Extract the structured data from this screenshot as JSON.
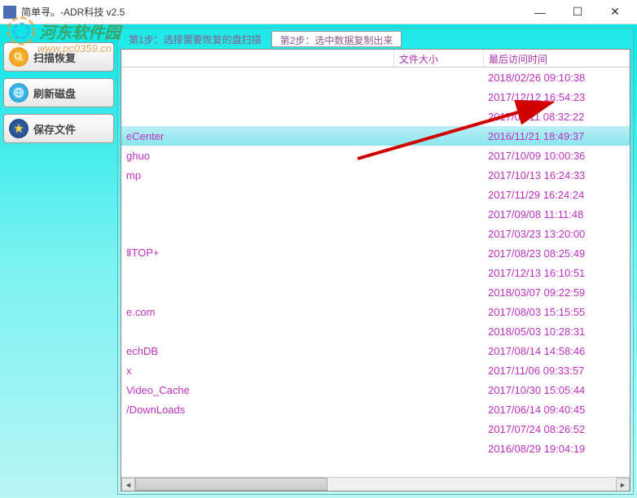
{
  "window": {
    "title": "简单寻。-ADR科技 v2.5"
  },
  "sidebar": {
    "scan_label": "扫描恢复",
    "refresh_label": "刷新磁盘",
    "save_label": "保存文件"
  },
  "steps": {
    "step1": "第1步：选择需要恢复的盘扫描",
    "step2": "第2步：选中数据复制出来"
  },
  "columns": {
    "name": "",
    "size": "文件大小",
    "date": "最后访问时间"
  },
  "rows": [
    {
      "name": "",
      "size": "",
      "date": "2018/02/26 09:10:38",
      "selected": false
    },
    {
      "name": "",
      "size": "",
      "date": "2017/12/12 16:54:23",
      "selected": false
    },
    {
      "name": "",
      "size": "",
      "date": "2017/06/11 08:32:22",
      "selected": false
    },
    {
      "name": "eCenter",
      "size": "",
      "date": "2016/11/21 18:49:37",
      "selected": true
    },
    {
      "name": "ghuo",
      "size": "",
      "date": "2017/10/09 10:00:36",
      "selected": false
    },
    {
      "name": "mp",
      "size": "",
      "date": "2017/10/13 16:24:33",
      "selected": false
    },
    {
      "name": "",
      "size": "",
      "date": "2017/11/29 16:24:24",
      "selected": false
    },
    {
      "name": "",
      "size": "",
      "date": "2017/09/08 11:11:48",
      "selected": false
    },
    {
      "name": "",
      "size": "",
      "date": "2017/03/23 13:20:00",
      "selected": false
    },
    {
      "name": "ⅡTOP+",
      "size": "",
      "date": "2017/08/23 08:25:49",
      "selected": false
    },
    {
      "name": "",
      "size": "",
      "date": "2017/12/13 16:10:51",
      "selected": false
    },
    {
      "name": "",
      "size": "",
      "date": "2018/03/07 09:22:59",
      "selected": false
    },
    {
      "name": "e.com",
      "size": "",
      "date": "2017/08/03 15:15:55",
      "selected": false
    },
    {
      "name": "",
      "size": "",
      "date": "2018/05/03 10:28:31",
      "selected": false
    },
    {
      "name": "echDB",
      "size": "",
      "date": "2017/08/14 14:58:46",
      "selected": false
    },
    {
      "name": "x",
      "size": "",
      "date": "2017/11/06 09:33:57",
      "selected": false
    },
    {
      "name": "Video_Cache",
      "size": "",
      "date": "2017/10/30 15:05:44",
      "selected": false
    },
    {
      "name": "/DownLoads",
      "size": "",
      "date": "2017/06/14 09:40:45",
      "selected": false
    },
    {
      "name": "",
      "size": "",
      "date": "2017/07/24 08:26:52",
      "selected": false
    },
    {
      "name": "",
      "size": "",
      "date": "2016/08/29 19:04:19",
      "selected": false
    }
  ],
  "watermark": {
    "text": "河东软件园",
    "url": "www.pc0359.cn"
  }
}
